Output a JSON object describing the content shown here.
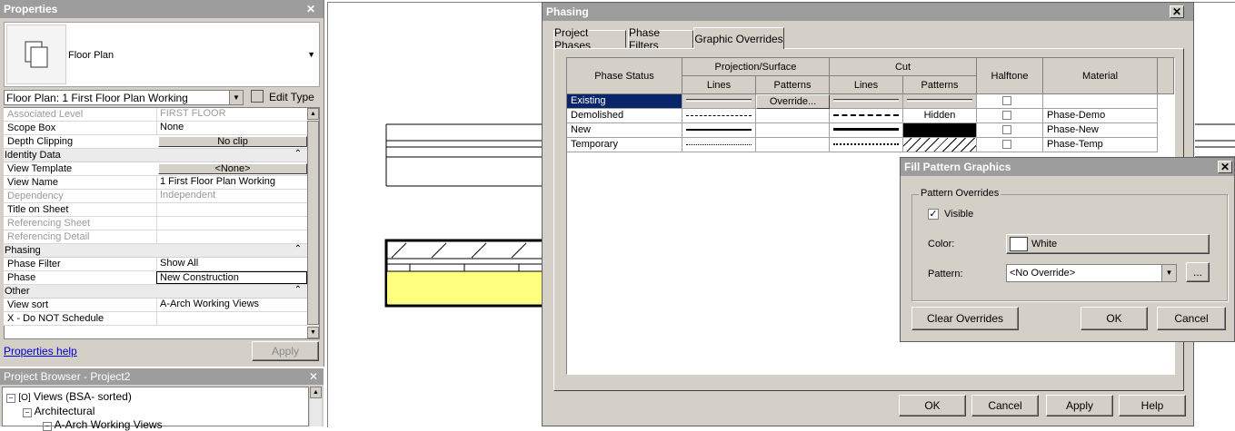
{
  "properties": {
    "title": "Properties",
    "type_name": "Floor Plan",
    "instance_selector": "Floor Plan: 1 First Floor Plan Working",
    "edit_type": "Edit Type",
    "rows": {
      "associated_level": {
        "label": "Associated Level",
        "value": "FIRST FLOOR"
      },
      "scope_box": {
        "label": "Scope Box",
        "value": "None"
      },
      "depth_clipping": {
        "label": "Depth Clipping",
        "value": "No clip"
      },
      "identity_group": "Identity Data",
      "view_template": {
        "label": "View Template",
        "value": "<None>"
      },
      "view_name": {
        "label": "View Name",
        "value": "1 First Floor Plan Working"
      },
      "dependency": {
        "label": "Dependency",
        "value": "Independent"
      },
      "title_on_sheet": {
        "label": "Title on Sheet",
        "value": ""
      },
      "referencing_sheet": {
        "label": "Referencing Sheet",
        "value": ""
      },
      "referencing_detail": {
        "label": "Referencing Detail",
        "value": ""
      },
      "phasing_group": "Phasing",
      "phase_filter": {
        "label": "Phase Filter",
        "value": "Show All"
      },
      "phase": {
        "label": "Phase",
        "value": "New Construction"
      },
      "other_group": "Other",
      "view_sort": {
        "label": "View sort",
        "value": "A-Arch Working Views"
      },
      "do_not_schedule": {
        "label": "X - Do NOT Schedule",
        "value": ""
      }
    },
    "help_link": "Properties help",
    "apply": "Apply"
  },
  "browser": {
    "title": "Project Browser - Project2",
    "items": [
      "Views (BSA- sorted)",
      "Architectural",
      "A-Arch Working Views"
    ]
  },
  "phasing": {
    "title": "Phasing",
    "tabs": [
      "Project Phases",
      "Phase Filters",
      "Graphic Overrides"
    ],
    "headers": {
      "phase_status": "Phase Status",
      "projection": "Projection/Surface",
      "cut": "Cut",
      "lines": "Lines",
      "patterns": "Patterns",
      "halftone": "Halftone",
      "material": "Material"
    },
    "rows": [
      {
        "status": "Existing",
        "proj_pattern": "Override...",
        "cut_pattern": "",
        "material": ""
      },
      {
        "status": "Demolished",
        "proj_pattern": "",
        "cut_pattern": "Hidden",
        "material": "Phase-Demo"
      },
      {
        "status": "New",
        "proj_pattern": "",
        "cut_pattern": "",
        "material": "Phase-New"
      },
      {
        "status": "Temporary",
        "proj_pattern": "",
        "cut_pattern": "",
        "material": "Phase-Temp"
      }
    ],
    "buttons": {
      "ok": "OK",
      "cancel": "Cancel",
      "apply": "Apply",
      "help": "Help"
    }
  },
  "fill_pattern": {
    "title": "Fill Pattern Graphics",
    "group": "Pattern Overrides",
    "visible_label": "Visible",
    "visible_checked": true,
    "color_label": "Color:",
    "color_value": "White",
    "pattern_label": "Pattern:",
    "pattern_value": "<No Override>",
    "browse": "...",
    "clear": "Clear Overrides",
    "ok": "OK",
    "cancel": "Cancel"
  },
  "colors": {
    "selection": "#0a246a",
    "dialog_bg": "#d4d0c8",
    "canvas_fill": "#ffff80"
  }
}
